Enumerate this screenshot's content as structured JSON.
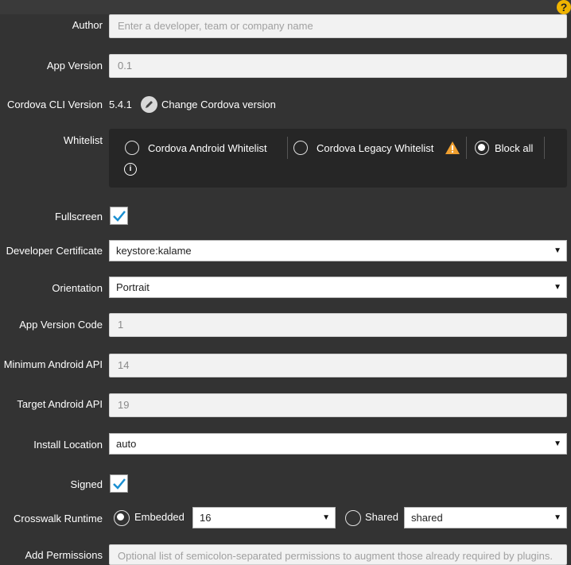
{
  "help": {
    "glyph": "?"
  },
  "form": {
    "author": {
      "label": "Author",
      "placeholder": "Enter a developer, team or company name"
    },
    "app_version": {
      "label": "App Version",
      "value": "0.1"
    },
    "cordova_cli": {
      "label": "Cordova CLI Version",
      "value": "5.4.1",
      "change_label": "Change Cordova version"
    },
    "whitelist": {
      "label": "Whitelist",
      "options": [
        {
          "label": "Cordova Android Whitelist",
          "selected": false
        },
        {
          "label": "Cordova Legacy Whitelist",
          "selected": false,
          "warning": true
        },
        {
          "label": "Block all",
          "selected": true
        }
      ],
      "info_glyph": "i"
    },
    "fullscreen": {
      "label": "Fullscreen",
      "checked": true
    },
    "developer_certificate": {
      "label": "Developer Certificate",
      "value": "keystore:kalame"
    },
    "orientation": {
      "label": "Orientation",
      "value": "Portrait"
    },
    "app_version_code": {
      "label": "App Version Code",
      "value": "1"
    },
    "min_android_api": {
      "label": "Minimum Android API",
      "value": "14"
    },
    "target_android_api": {
      "label": "Target Android API",
      "value": "19"
    },
    "install_location": {
      "label": "Install Location",
      "value": "auto"
    },
    "signed": {
      "label": "Signed",
      "checked": true
    },
    "crosswalk": {
      "label": "Crosswalk Runtime",
      "embedded_label": "Embedded",
      "embedded_selected": true,
      "embedded_value": "16",
      "shared_label": "Shared",
      "shared_selected": false,
      "shared_value": "shared"
    },
    "add_permissions": {
      "label": "Add Permissions",
      "placeholder": "Optional list of semicolon-separated permissions to augment those already required by plugins."
    }
  },
  "colors": {
    "background": "#333333",
    "check_accent": "#1a8fd1",
    "warning": "#f0a030",
    "help": "#f0b400"
  },
  "arrow_glyph": "▼"
}
